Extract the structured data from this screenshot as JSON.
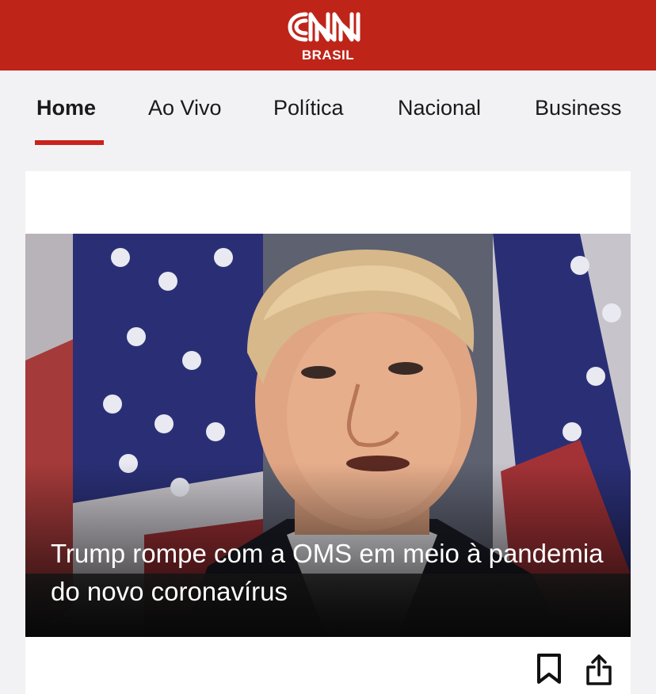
{
  "header": {
    "logo_text": "CNN",
    "logo_subtext": "BRASIL",
    "brand_color": "#bf2419"
  },
  "nav": {
    "items": [
      {
        "label": "Home",
        "active": true
      },
      {
        "label": "Ao Vivo",
        "active": false
      },
      {
        "label": "Política",
        "active": false
      },
      {
        "label": "Nacional",
        "active": false
      },
      {
        "label": "Business",
        "active": false
      }
    ],
    "active_color": "#c8231c"
  },
  "article": {
    "headline": "Trump rompe com a OMS em meio à pandemia do novo coronavírus",
    "image_icon": "news-photo",
    "actions": [
      {
        "icon": "bookmark-icon"
      },
      {
        "icon": "share-icon"
      }
    ]
  }
}
